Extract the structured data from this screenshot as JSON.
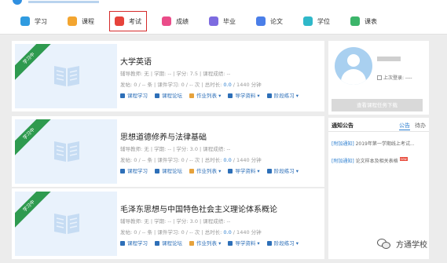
{
  "nav": {
    "items": [
      {
        "label": "学习",
        "icon": "study-icon",
        "color": "#2f9be0"
      },
      {
        "label": "课程",
        "icon": "course-icon",
        "color": "#f3a530"
      },
      {
        "label": "考试",
        "icon": "exam-icon",
        "color": "#e6433b"
      },
      {
        "label": "成绩",
        "icon": "grade-icon",
        "color": "#ea4c89"
      },
      {
        "label": "毕业",
        "icon": "graduation-icon",
        "color": "#7d6be0"
      },
      {
        "label": "论文",
        "icon": "thesis-icon",
        "color": "#4a7ee8"
      },
      {
        "label": "学位",
        "icon": "degree-icon",
        "color": "#2fb8c9"
      },
      {
        "label": "课表",
        "icon": "schedule-icon",
        "color": "#3cb56a"
      }
    ],
    "active_index": 2,
    "active_outline_color": "#d42a2a"
  },
  "courses": [
    {
      "badge": "学习中",
      "title": "大学英语",
      "teacher_label": "辅导教师: 无",
      "credit_label": "学期: --",
      "score_label": "学分: 7.5",
      "grade_label": "课程成绩: --",
      "posts": "发帖: 0 / -- 条",
      "study": "课件学习: 0 / -- 次",
      "time_prefix": "总时长: ",
      "time_value": "0.0",
      "time_suffix": " / 1440 分钟",
      "links": [
        "课程学习",
        "课程论坛",
        "作业列表",
        "导学资料",
        "阶段练习"
      ]
    },
    {
      "badge": "学习中",
      "title": "思想道德修养与法律基础",
      "teacher_label": "辅导教师: 无",
      "credit_label": "学期: --",
      "score_label": "学分: 3.0",
      "grade_label": "课程成绩: --",
      "posts": "发帖: 0 / -- 条",
      "study": "课件学习: 0 / -- 次",
      "time_prefix": "总时长: ",
      "time_value": "0.0",
      "time_suffix": " / 1440 分钟",
      "links": [
        "课程学习",
        "课程论坛",
        "作业列表",
        "导学资料",
        "阶段练习"
      ]
    },
    {
      "badge": "学习中",
      "title": "毛泽东思想与中国特色社会主义理论体系概论",
      "teacher_label": "辅导教师: 无",
      "credit_label": "学期: --",
      "score_label": "学分: 3.0",
      "grade_label": "课程成绩: --",
      "posts": "发帖: 0 / -- 条",
      "study": "课件学习: 0 / -- 次",
      "time_prefix": "总时长: ",
      "time_value": "0.0",
      "time_suffix": " / 1440 分钟",
      "links": [
        "课程学习",
        "课程论坛",
        "作业列表",
        "导学资料",
        "阶段练习"
      ]
    }
  ],
  "profile": {
    "last_login": "上次登录: ----",
    "download_button": "查看课程任务下载"
  },
  "notice": {
    "title": "通知公告",
    "tab_announce": "公告",
    "tab_pending": "待办",
    "items": [
      {
        "tag": "[附加通知]",
        "text": "2019年第一学期线上考试...",
        "new": ""
      },
      {
        "tag": "[附加通知]",
        "text": "论文样本及相关表格",
        "new": "new"
      }
    ]
  },
  "watermark": "方通学校",
  "colors": {
    "link": "#2d6fb8",
    "badge": "#2e9a4f",
    "time_value": "#2d7fd0"
  }
}
